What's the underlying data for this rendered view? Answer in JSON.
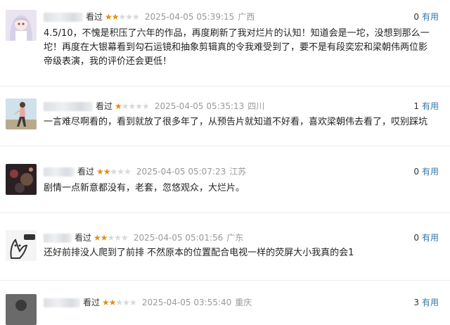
{
  "reviews": [
    {
      "rating_label": "看过",
      "stars_on": "★★",
      "stars_off": "★★★",
      "rating": 2,
      "time": "2025-04-05 05:39:15",
      "location": "广西",
      "votes": "0",
      "useful_label": "有用",
      "content": "4.5/10，不愧是积压了六年的作品，再度刷新了我对烂片的认知！知道会是一坨，没想到那么一坨！再度在大银幕看到勾石运镜和抽象剪辑真的令我难受到了，要不是有段奕宏和梁朝伟两位影帝级表演，我的评价还会更低！"
    },
    {
      "rating_label": "看过",
      "stars_on": "★",
      "stars_off": "★★★★",
      "rating": 1,
      "time": "2025-04-05 05:35:13",
      "location": "四川",
      "votes": "1",
      "useful_label": "有用",
      "content": "一言难尽啊看的，看到就放了很多年了，从预告片就知道不好看，喜欢梁朝伟去看了，哎别踩坑"
    },
    {
      "rating_label": "看过",
      "stars_on": "★★",
      "stars_off": "★★★",
      "rating": 2,
      "time": "2025-04-05 05:07:23",
      "location": "江苏",
      "votes": "0",
      "useful_label": "有用",
      "content": "剧情一点新意都没有，老套，忽悠观众，大烂片。"
    },
    {
      "rating_label": "看过",
      "stars_on": "★★",
      "stars_off": "★★★",
      "rating": 2,
      "time": "2025-04-05 05:01:56",
      "location": "广东",
      "votes": "0",
      "useful_label": "有用",
      "content": "还好前排没人爬到了前排 不然原本的位置配合电视一样的荧屏大小我真的会1"
    },
    {
      "rating_label": "看过",
      "stars_on": "★★",
      "stars_off": "★★★",
      "rating": 2,
      "time": "2025-04-05 03:55:40",
      "location": "重庆",
      "votes": "3",
      "useful_label": "有用",
      "content": ""
    }
  ]
}
